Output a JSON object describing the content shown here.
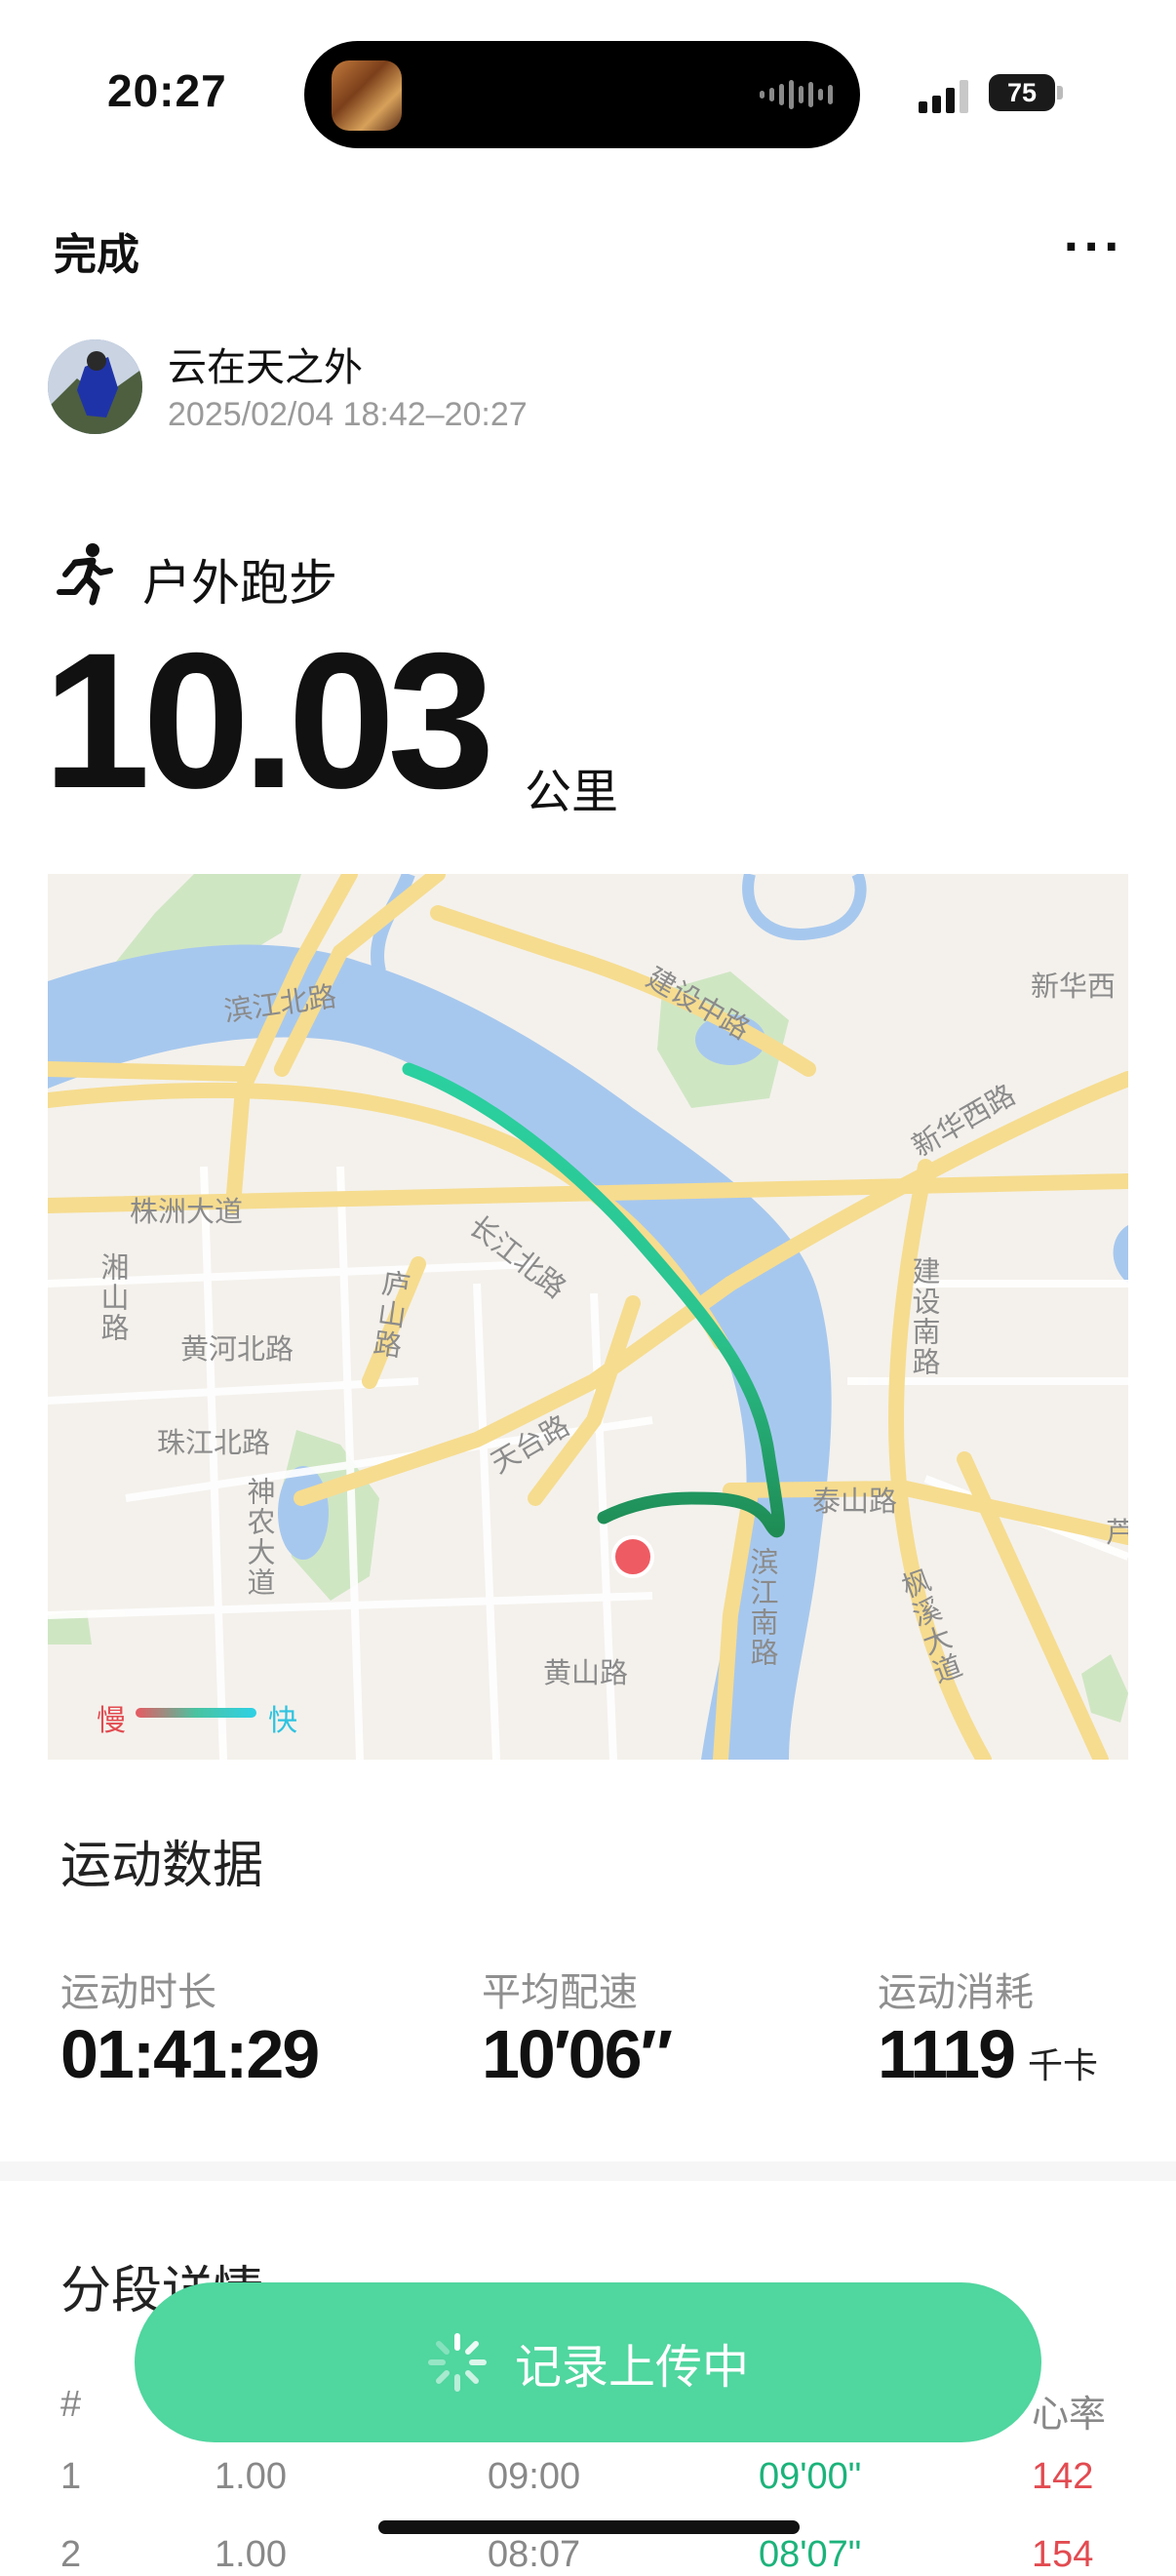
{
  "status_bar": {
    "time": "20:27",
    "battery": "75"
  },
  "header": {
    "done_label": "完成",
    "more_label": "···"
  },
  "user": {
    "name": "云在天之外",
    "datetime": "2025/02/04 18:42–20:27"
  },
  "activity": {
    "type": "户外跑步",
    "distance": "10.03",
    "unit": "公里"
  },
  "map": {
    "labels": {
      "binjiang_bei": "滨江北路",
      "jianshe_zhong": "建设中路",
      "xinhua_xi": "新华西",
      "xinhua_xi_road": "新华西路",
      "zhuzhou": "株洲大道",
      "changjiang_bei": "长江北路",
      "xiangshan": "湘山路",
      "lushan": "庐山路",
      "huanghe_bei": "黄河北路",
      "jianshe_nan": "建设南路",
      "zhujiang_bei": "珠江北路",
      "tiantai": "天台路",
      "taishan": "泰山路",
      "shennong": "神农大道",
      "binjiang_nan": "滨江南路",
      "fengxi": "枫溪大道",
      "huangshan": "黄山路",
      "edge": "芦"
    },
    "legend": {
      "slow": "慢",
      "fast": "快"
    },
    "colors": {
      "water": "#a7c8ee",
      "road": "#f6dc8f",
      "park": "#cfe6c3",
      "route_fast": "#2bd0a0",
      "route_slow": "#1f8c55",
      "marker": "#ef5b63"
    }
  },
  "stats": {
    "title": "运动数据",
    "duration": {
      "label": "运动时长",
      "value": "01:41:29"
    },
    "pace": {
      "label": "平均配速",
      "value": "10′06″"
    },
    "calories": {
      "label": "运动消耗",
      "value": "1119",
      "unit": "千卡"
    }
  },
  "segments": {
    "title": "分段详情",
    "headers": {
      "index": "#",
      "heart_rate": "心率"
    },
    "rows": [
      {
        "index": "1",
        "distance": "1.00",
        "time": "09:00",
        "pace": "09'00\"",
        "heart_rate": "142"
      },
      {
        "index": "2",
        "distance": "1.00",
        "time": "08:07",
        "pace": "08'07\"",
        "heart_rate": "154"
      }
    ]
  },
  "upload": {
    "label": "记录上传中"
  }
}
